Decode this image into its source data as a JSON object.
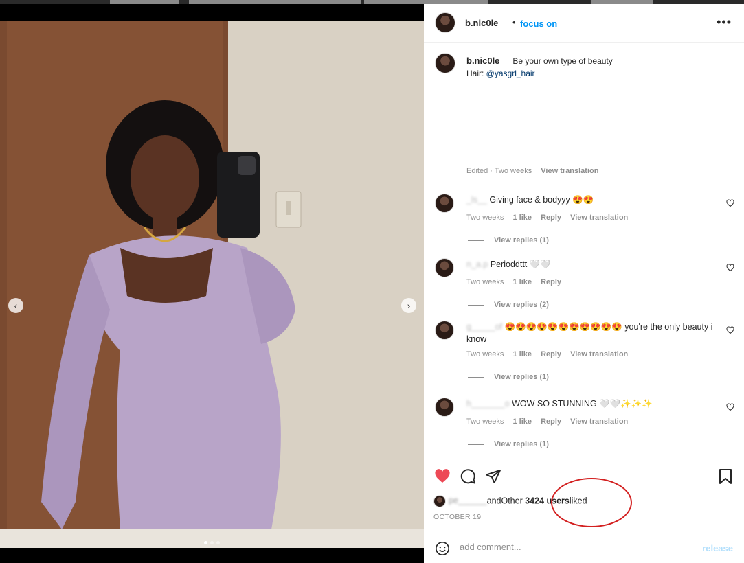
{
  "header": {
    "username": "b.nic0le__",
    "separator": "•",
    "follow_label": "focus on",
    "more_label": "•••"
  },
  "caption": {
    "username": "b.nic0le__",
    "text": "Be your own type of beauty",
    "hair_prefix": "Hair: ",
    "hair_handle": "@yasgrl_hair",
    "edited": "Edited",
    "dot": "·",
    "time": "Two weeks",
    "translate": "View translation"
  },
  "comments": [
    {
      "user": "_ls__",
      "text": "Giving face & bodyyy 😍😍",
      "time": "Two weeks",
      "likes": "1 like",
      "reply": "Reply",
      "translate": "View translation",
      "view_replies": "View replies (1)"
    },
    {
      "user": "n_a.p",
      "text": "Perioddttt 🤍🤍",
      "time": "Two weeks",
      "likes": "1 like",
      "reply": "Reply",
      "translate": "",
      "view_replies": "View replies (2)"
    },
    {
      "user": "g_____of",
      "text": "😍😍😍😍😍😍😍😍😍😍😍 you're the only beauty i know",
      "time": "Two weeks",
      "likes": "1 like",
      "reply": "Reply",
      "translate": "View translation",
      "view_replies": "View replies (1)"
    },
    {
      "user": "h_______o",
      "text": "WOW SO STUNNING 🤍🤍✨✨✨",
      "time": "Two weeks",
      "likes": "1 like",
      "reply": "Reply",
      "translate": "View translation",
      "view_replies": "View replies (1)"
    }
  ],
  "likes": {
    "blurred_user": "pe______",
    "and_other": "andOther",
    "count": "3424 users",
    "suffix": "liked"
  },
  "date": "OCTOBER 19",
  "add_comment": {
    "placeholder": "add comment...",
    "release_label": "release"
  },
  "colors": {
    "accent": "#0095f6",
    "like_red": "#ed4956",
    "annotation": "#d32020"
  },
  "icons": [
    "more-icon",
    "heart-icon",
    "comment-icon",
    "share-icon",
    "bookmark-icon",
    "emoji-icon",
    "chevron-left-icon",
    "chevron-right-icon"
  ]
}
